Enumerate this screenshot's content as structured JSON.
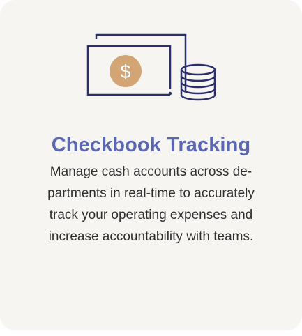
{
  "card": {
    "title": "Checkbook Tracking",
    "description_lines": [
      "Manage cash accounts across de-",
      "partments in real-time to accurately",
      "track your operating expenses and",
      "increase accountability with teams."
    ]
  },
  "illustration": {
    "icon": "cash-and-coins-icon",
    "coin_symbol": "$",
    "colors": {
      "stroke": "#2b2f6b",
      "coin": "#d3a574",
      "coin_symbol": "#ffffff"
    }
  },
  "colors": {
    "card_background": "#f6f5f2",
    "title": "#5b68b0",
    "body_text": "#2f2f2f"
  }
}
